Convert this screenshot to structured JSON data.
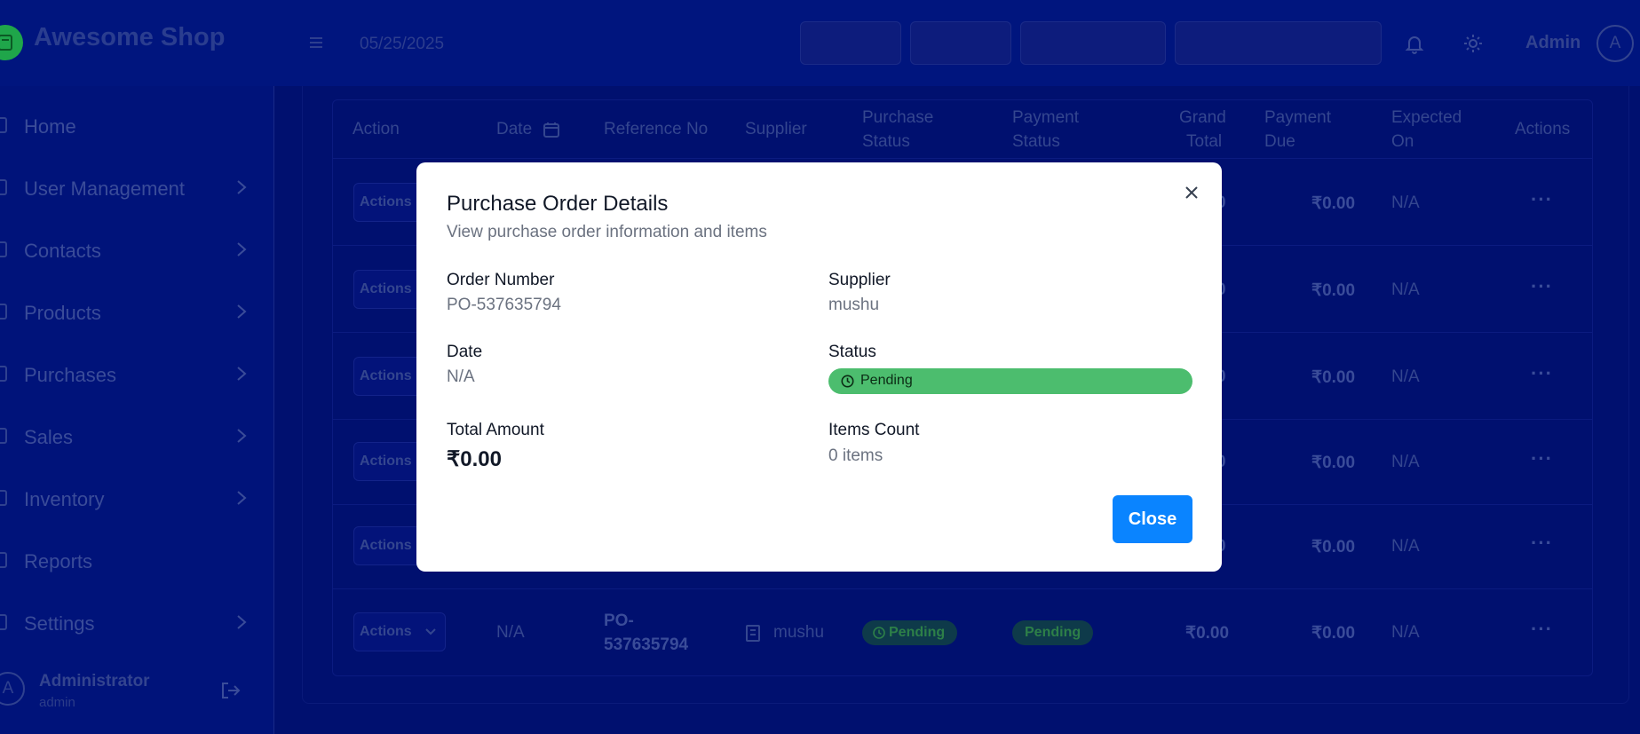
{
  "header": {
    "brand": "Awesome Shop",
    "date": "05/25/2025",
    "user_name": "Admin",
    "user_initial": "A"
  },
  "sidebar": {
    "items": [
      {
        "label": "Home",
        "has_submenu": false
      },
      {
        "label": "User Management",
        "has_submenu": true
      },
      {
        "label": "Contacts",
        "has_submenu": true
      },
      {
        "label": "Products",
        "has_submenu": true
      },
      {
        "label": "Purchases",
        "has_submenu": true
      },
      {
        "label": "Sales",
        "has_submenu": true
      },
      {
        "label": "Inventory",
        "has_submenu": true
      },
      {
        "label": "Reports",
        "has_submenu": false
      },
      {
        "label": "Settings",
        "has_submenu": true
      }
    ],
    "user": {
      "initial": "A",
      "name": "Administrator",
      "role": "admin"
    }
  },
  "table": {
    "headers": {
      "action": "Action",
      "date": "Date",
      "reference": "Reference No",
      "supplier": "Supplier",
      "purchase_status_1": "Purchase",
      "purchase_status_2": "Status",
      "payment_status_1": "Payment",
      "payment_status_2": "Status",
      "grand_total_1": "Grand",
      "grand_total_2": "Total",
      "payment_due_1": "Payment",
      "payment_due_2": "Due",
      "expected_on_1": "Expected",
      "expected_on_2": "On",
      "actions": "Actions"
    },
    "rows": [
      {
        "action": "Actions",
        "grand_total_fragment": "0",
        "payment_due": "₹0.00",
        "expected_on": "N/A",
        "more": "···"
      },
      {
        "action": "Actions",
        "grand_total_fragment": "0",
        "payment_due": "₹0.00",
        "expected_on": "N/A",
        "more": "···"
      },
      {
        "action": "Actions",
        "grand_total_fragment": "0",
        "payment_due": "₹0.00",
        "expected_on": "N/A",
        "more": "···"
      },
      {
        "action": "Actions",
        "grand_total_fragment": "0",
        "payment_due": "₹0.00",
        "expected_on": "N/A",
        "more": "···"
      },
      {
        "action": "Actions",
        "grand_total_fragment": "0",
        "payment_due": "₹0.00",
        "expected_on": "N/A",
        "more": "···"
      }
    ],
    "last_row": {
      "action": "Actions",
      "date": "N/A",
      "reference_1": "PO-",
      "reference_2": "537635794",
      "supplier": "mushu",
      "purchase_status": "Pending",
      "payment_status": "Pending",
      "grand_total": "₹0.00",
      "payment_due": "₹0.00",
      "expected_on": "N/A",
      "more": "···"
    }
  },
  "modal": {
    "title": "Purchase Order Details",
    "subtitle": "View purchase order information and items",
    "order_number_label": "Order Number",
    "order_number": "PO-537635794",
    "supplier_label": "Supplier",
    "supplier": "mushu",
    "date_label": "Date",
    "date": "N/A",
    "status_label": "Status",
    "status": "Pending",
    "total_label": "Total Amount",
    "total": "₹0.00",
    "items_label": "Items Count",
    "items": "0 items",
    "close_label": "Close"
  },
  "colors": {
    "accent": "#0a84ff",
    "status_pending": "#4cbd6e",
    "overlay_navy": "#00106f"
  }
}
